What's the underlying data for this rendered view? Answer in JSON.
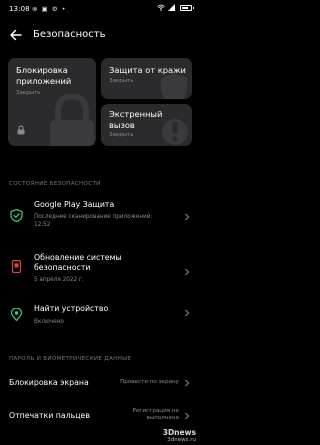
{
  "status": {
    "time": "13:08",
    "left_icons": "⊗ ▣ ⚙ •",
    "right_icons": "◔ ≋ ▲"
  },
  "header": {
    "title": "Безопасность"
  },
  "tiles": {
    "app_lock": {
      "title": "Блокировка приложений",
      "subtitle": "Закрыть"
    },
    "theft": {
      "title": "Защита от кражи",
      "subtitle": "Закрыть"
    },
    "emergency": {
      "title": "Экстренный вызов",
      "subtitle": "Закрыть"
    }
  },
  "sections": {
    "status_title": "СОСТОЯНИЕ БЕЗОПАСНОСТИ",
    "biometric_title": "ПАРОЛЬ И БИОМЕТРИЧЕСКИЕ ДАННЫЕ"
  },
  "rows": {
    "play": {
      "title": "Google Play Защита",
      "subtitle": "Последнее сканирование приложений: 12:52"
    },
    "update": {
      "title": "Обновление системы безопасности",
      "subtitle": "5 апреля 2022 г."
    },
    "find": {
      "title": "Найти устройство",
      "subtitle": "Включено"
    },
    "screen_lock": {
      "title": "Блокировка экрана",
      "value": "Провести по экрану"
    },
    "fingerprint": {
      "title": "Отпечатки пальцев",
      "value": "Регистрация не выполнена"
    }
  },
  "watermark": {
    "brand": "3Dnews",
    "domain": "3dnews.ru"
  },
  "colors": {
    "accent_green": "#3fcf6b",
    "update_red": "#e0483e",
    "tile_bg": "#2b2b2d"
  }
}
